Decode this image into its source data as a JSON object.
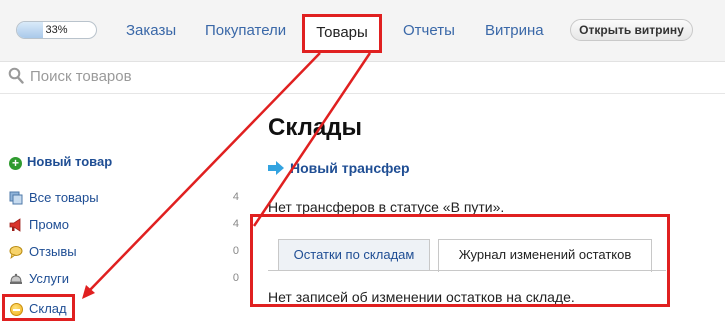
{
  "topnav": {
    "progress": {
      "label": "33%",
      "value": 0.33
    },
    "items": [
      {
        "label": "Заказы"
      },
      {
        "label": "Покупатели"
      },
      {
        "label": "Товары",
        "active": true
      },
      {
        "label": "Отчеты"
      },
      {
        "label": "Витрина"
      }
    ],
    "open_storefront": "Открыть витрину"
  },
  "search": {
    "placeholder": "Поиск товаров",
    "value": ""
  },
  "sidebar": {
    "new_product": "Новый товар",
    "items": [
      {
        "label": "Все товары",
        "count": "4",
        "icon": "stack-icon"
      },
      {
        "label": "Промо",
        "count": "4",
        "icon": "megaphone-icon"
      },
      {
        "label": "Отзывы",
        "count": "0",
        "icon": "review-icon"
      },
      {
        "label": "Услуги",
        "count": "0",
        "icon": "service-bell-icon"
      },
      {
        "label": "Склад",
        "active": true,
        "icon": "warehouse-icon"
      }
    ]
  },
  "main": {
    "title": "Склады",
    "new_transfer": "Новый трансфер",
    "transit_status": "Нет трансферов в статусе «В пути».",
    "tabs": [
      {
        "label": "Остатки по складам",
        "active": false
      },
      {
        "label": "Журнал изменений остатков",
        "active": true
      }
    ],
    "empty_log": "Нет записей об изменении остатков на складе."
  },
  "colors": {
    "accent_link": "#1f4e94",
    "nav_link": "#3a68a8",
    "highlight": "#e02020",
    "plus_green": "#2f9b2f"
  }
}
